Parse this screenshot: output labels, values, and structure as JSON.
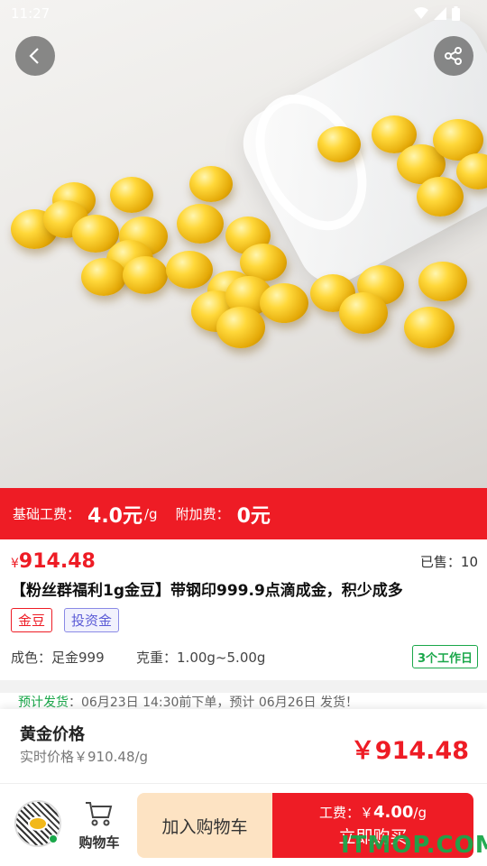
{
  "status_bar": {
    "time": "11:27"
  },
  "promo": {
    "base_fee_label": "基础工费：",
    "base_fee_value": "4.0元",
    "base_fee_unit": "/g",
    "extra_fee_label": "附加费：",
    "extra_fee_value": "0元"
  },
  "product": {
    "currency": "¥",
    "price": "914.48",
    "sold_label": "已售：",
    "sold_count": "10",
    "title": "【粉丝群福利1g金豆】带钢印999.9点滴成金，积少成多",
    "tags": [
      "金豆",
      "投资金"
    ],
    "purity_label": "成色：",
    "purity_value": "足金999",
    "weight_label": "克重：",
    "weight_value": "1.00g~5.00g",
    "delivery_badge": "3个工作日"
  },
  "delivery_notice": {
    "label": "预计发货",
    "text": "：06月23日 14:30前下单，预计 06月26日 发货！"
  },
  "gold_sheet": {
    "title": "黄金价格",
    "realtime": "实时价格￥910.48/g",
    "price": "￥914.48"
  },
  "bottom_bar": {
    "cart_label": "购物车",
    "add_to_cart": "加入购物车",
    "fee_prefix": "工费：￥",
    "fee_value": "4.00",
    "fee_unit": "/g",
    "buy_now": "立即购买"
  },
  "watermark": "ITMOP.COM",
  "colors": {
    "accent_red": "#ee1c25",
    "green": "#1aa74a",
    "cart_bg": "#fde3c3"
  }
}
